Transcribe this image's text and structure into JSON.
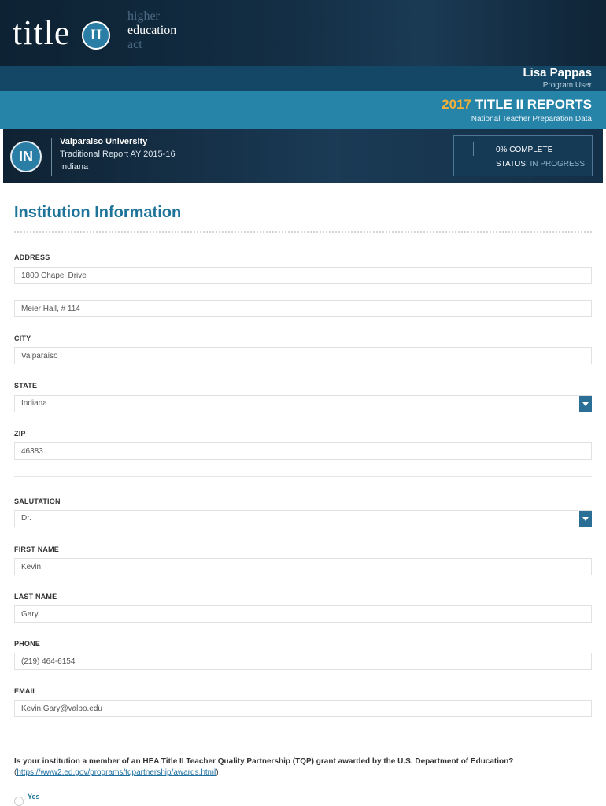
{
  "header": {
    "logo_title": "title",
    "logo_badge": "II",
    "logo_words": [
      "higher",
      "education",
      "act"
    ],
    "user_name": "Lisa Pappas",
    "user_role": "Program User",
    "report_year": "2017",
    "report_title": "TITLE II REPORTS",
    "report_subtitle": "National Teacher Preparation Data"
  },
  "institution": {
    "badge": "IN",
    "name": "Valparaiso University",
    "report": "Traditional Report AY 2015-16",
    "state": "Indiana",
    "progress_percent": 0,
    "progress_label": "0% COMPLETE",
    "status_label": "STATUS:",
    "status_value": "IN PROGRESS"
  },
  "form": {
    "section_title": "Institution Information",
    "address_label": "ADDRESS",
    "address_line1": "1800 Chapel Drive",
    "address_line2": "Meier Hall, # 114",
    "city_label": "CITY",
    "city": "Valparaiso",
    "state_label": "STATE",
    "state": "Indiana",
    "zip_label": "ZIP",
    "zip": "46383",
    "salutation_label": "SALUTATION",
    "salutation": "Dr.",
    "first_name_label": "FIRST NAME",
    "first_name": "Kevin",
    "last_name_label": "LAST NAME",
    "last_name": "Gary",
    "phone_label": "PHONE",
    "phone": "(219) 464-6154",
    "email_label": "EMAIL",
    "email": "Kevin.Gary@valpo.edu",
    "tqp_question": "Is your institution a member of an HEA Title II Teacher Quality Partnership (TQP) grant awarded by the U.S. Department of Education?",
    "tqp_link_open": "(",
    "tqp_link": "https://www2.ed.gov/programs/tqpartnership/awards.html",
    "tqp_link_close": ")",
    "tqp_option_yes": "Yes"
  },
  "colors": {
    "accent": "#2784a9",
    "title_blue": "#1d7399",
    "year_gold": "#f1b13b",
    "header_dark": "#0d2233"
  }
}
